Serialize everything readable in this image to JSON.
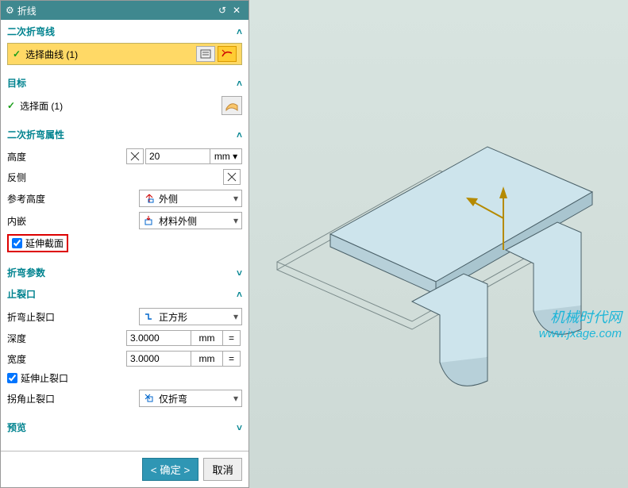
{
  "titlebar": {
    "title": "折线"
  },
  "s1": {
    "title": "二次折弯线",
    "sel_txt": "选择曲线 (1)"
  },
  "s2": {
    "title": "目标",
    "sel_txt": "选择面 (1)"
  },
  "s3": {
    "title": "二次折弯属性",
    "height_label": "高度",
    "height_val": "20",
    "height_unit": "mm",
    "flip_label": "反侧",
    "refh_label": "参考高度",
    "refh_val": "外侧",
    "inset_label": "内嵌",
    "inset_val": "材料外侧",
    "extend_label": "延伸截面"
  },
  "s4": {
    "title": "折弯参数"
  },
  "s5": {
    "title": "止裂口",
    "relief_label": "折弯止裂口",
    "relief_val": "正方形",
    "depth_label": "深度",
    "depth_val": "3.0000",
    "depth_unit": "mm",
    "width_label": "宽度",
    "width_val": "3.0000",
    "width_unit": "mm",
    "extend_relief": "延伸止裂口",
    "corner_relief_label": "拐角止裂口",
    "corner_relief_val": "仅折弯"
  },
  "s6": {
    "title": "预览"
  },
  "footer": {
    "ok": "< 确定 >",
    "cancel": "取消"
  },
  "watermark": {
    "line1": "机械时代网",
    "line2": "www.jxage.com"
  }
}
